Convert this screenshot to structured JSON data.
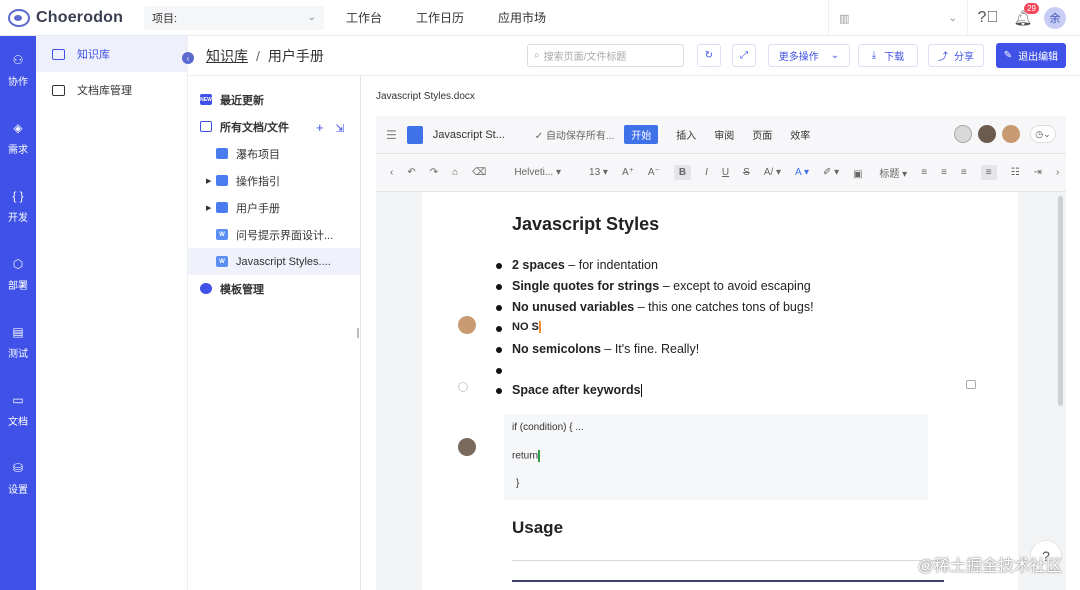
{
  "app": {
    "logo_text": "Choerodon"
  },
  "topbar": {
    "project_label": "项目:",
    "nav": [
      "工作台",
      "工作日历",
      "应用市场"
    ],
    "notification_count": "29",
    "user_avatar": "余"
  },
  "rail": [
    "协作",
    "需求",
    "开发",
    "部署",
    "测试",
    "文档",
    "设置"
  ],
  "col2": {
    "items": [
      "知识库",
      "文档库管理"
    ]
  },
  "header": {
    "breadcrumb_root": "知识库",
    "breadcrumb_sep": "/",
    "breadcrumb_current": "用户手册",
    "search_placeholder": "搜索页面/文件标题",
    "more_label": "更多操作",
    "download_label": "下载",
    "share_label": "分享",
    "exit_edit_label": "退出编辑"
  },
  "tree": {
    "recent": "最近更新",
    "all_docs": "所有文档/文件",
    "items": [
      {
        "label": "瀑布项目",
        "type": "doc",
        "expandable": false
      },
      {
        "label": "操作指引",
        "type": "doc",
        "expandable": true
      },
      {
        "label": "用户手册",
        "type": "doc",
        "expandable": true
      },
      {
        "label": "问号提示界面设计...",
        "type": "word",
        "expandable": false
      },
      {
        "label": "Javascript Styles....",
        "type": "word",
        "expandable": false,
        "selected": true
      }
    ],
    "template_mgmt": "模板管理"
  },
  "editor": {
    "file_name": "Javascript Styles.docx",
    "doc_title": "Javascript St...",
    "autosave": "自动保存所有...",
    "tabs": [
      "开始",
      "插入",
      "审阅",
      "页面",
      "效率"
    ],
    "font": "Helveti...",
    "font_size": "13",
    "heading_label": "标题",
    "content": {
      "title": "Javascript Styles",
      "bullets": [
        {
          "bold": "2 spaces",
          "rest": " – for indentation"
        },
        {
          "bold": "Single quotes for strings",
          "rest": " – except to avoid escaping"
        },
        {
          "bold": "No unused variables",
          "rest": " – this one catches tons of bugs!"
        },
        {
          "bold": "NO S",
          "rest": ""
        },
        {
          "bold": "No semicolons",
          "rest": " – It's fine. Really!"
        },
        {
          "bold": "",
          "rest": ""
        },
        {
          "bold": "Space after keywords",
          "rest": ""
        }
      ],
      "code_lines": [
        "if (condition) { ...",
        "return",
        "}"
      ],
      "section_heading": "Usage"
    }
  },
  "watermark": "@稀土掘金技术社区"
}
